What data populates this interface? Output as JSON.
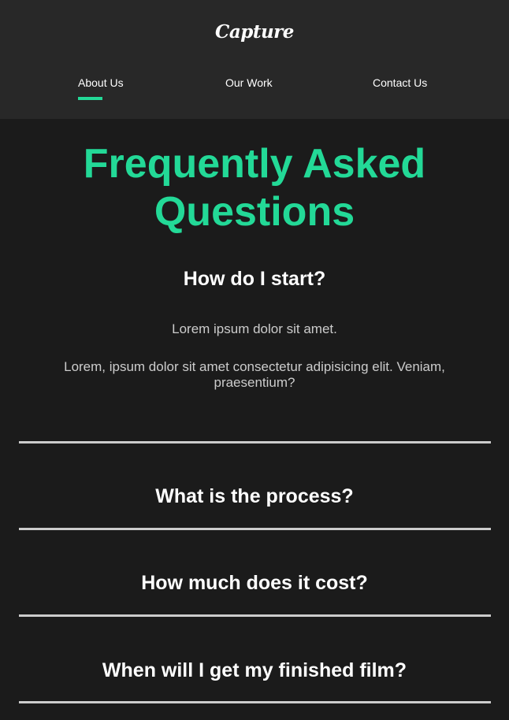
{
  "header": {
    "logo": "Capture",
    "nav": [
      {
        "label": "About Us",
        "active": true
      },
      {
        "label": "Our Work",
        "active": false
      },
      {
        "label": "Contact Us",
        "active": false
      }
    ]
  },
  "faq": {
    "title_line1": "Frequently Asked",
    "title_line2": "Questions",
    "items": [
      {
        "question": "How do I start?",
        "expanded": true,
        "answer": [
          "Lorem ipsum dolor sit amet.",
          "Lorem, ipsum dolor sit amet consectetur adipisicing elit. Veniam, praesentium?"
        ]
      },
      {
        "question": "What is the process?",
        "expanded": false
      },
      {
        "question": "How much does it cost?",
        "expanded": false
      },
      {
        "question": "When will I get my finished film?",
        "expanded": false
      }
    ]
  },
  "colors": {
    "accent": "#23d997",
    "header_bg": "#282828",
    "page_bg": "#1b1b1b",
    "divider": "#cccccc"
  }
}
